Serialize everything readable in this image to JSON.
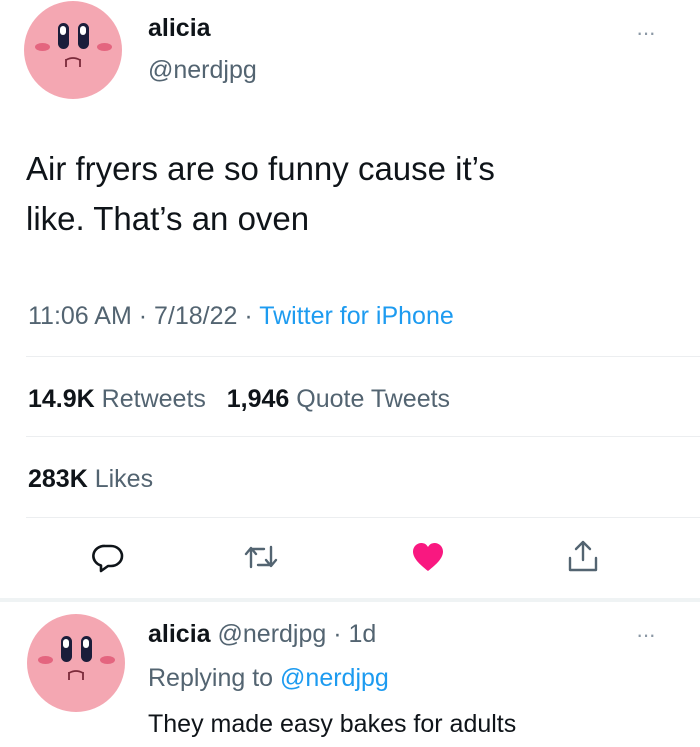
{
  "tweet": {
    "display_name": "alicia",
    "handle": "@nerdjpg",
    "text_line1": "Air fryers are so funny cause it’s",
    "text_line2": "like. That’s an oven",
    "time": "11:06 AM",
    "date": "7/18/22",
    "source": "Twitter for iPhone",
    "retweets_count": "14.9K",
    "retweets_label": "Retweets",
    "quotes_count": "1,946",
    "quotes_label": "Quote Tweets",
    "likes_count": "283K",
    "likes_label": "Likes",
    "more_glyph": "···"
  },
  "reply": {
    "display_name": "alicia",
    "handle": "@nerdjpg",
    "age": "1d",
    "replying_prefix": "Replying to",
    "replying_to": "@nerdjpg",
    "text": "They made easy bakes for adults",
    "more_glyph": "···"
  },
  "icons": {
    "reply": "speech-bubble-icon",
    "retweet": "retweet-icon",
    "like": "heart-icon",
    "share": "share-icon"
  },
  "colors": {
    "link": "#1d9bf0",
    "liked": "#f91880",
    "avatar": "#f4a7b2"
  }
}
